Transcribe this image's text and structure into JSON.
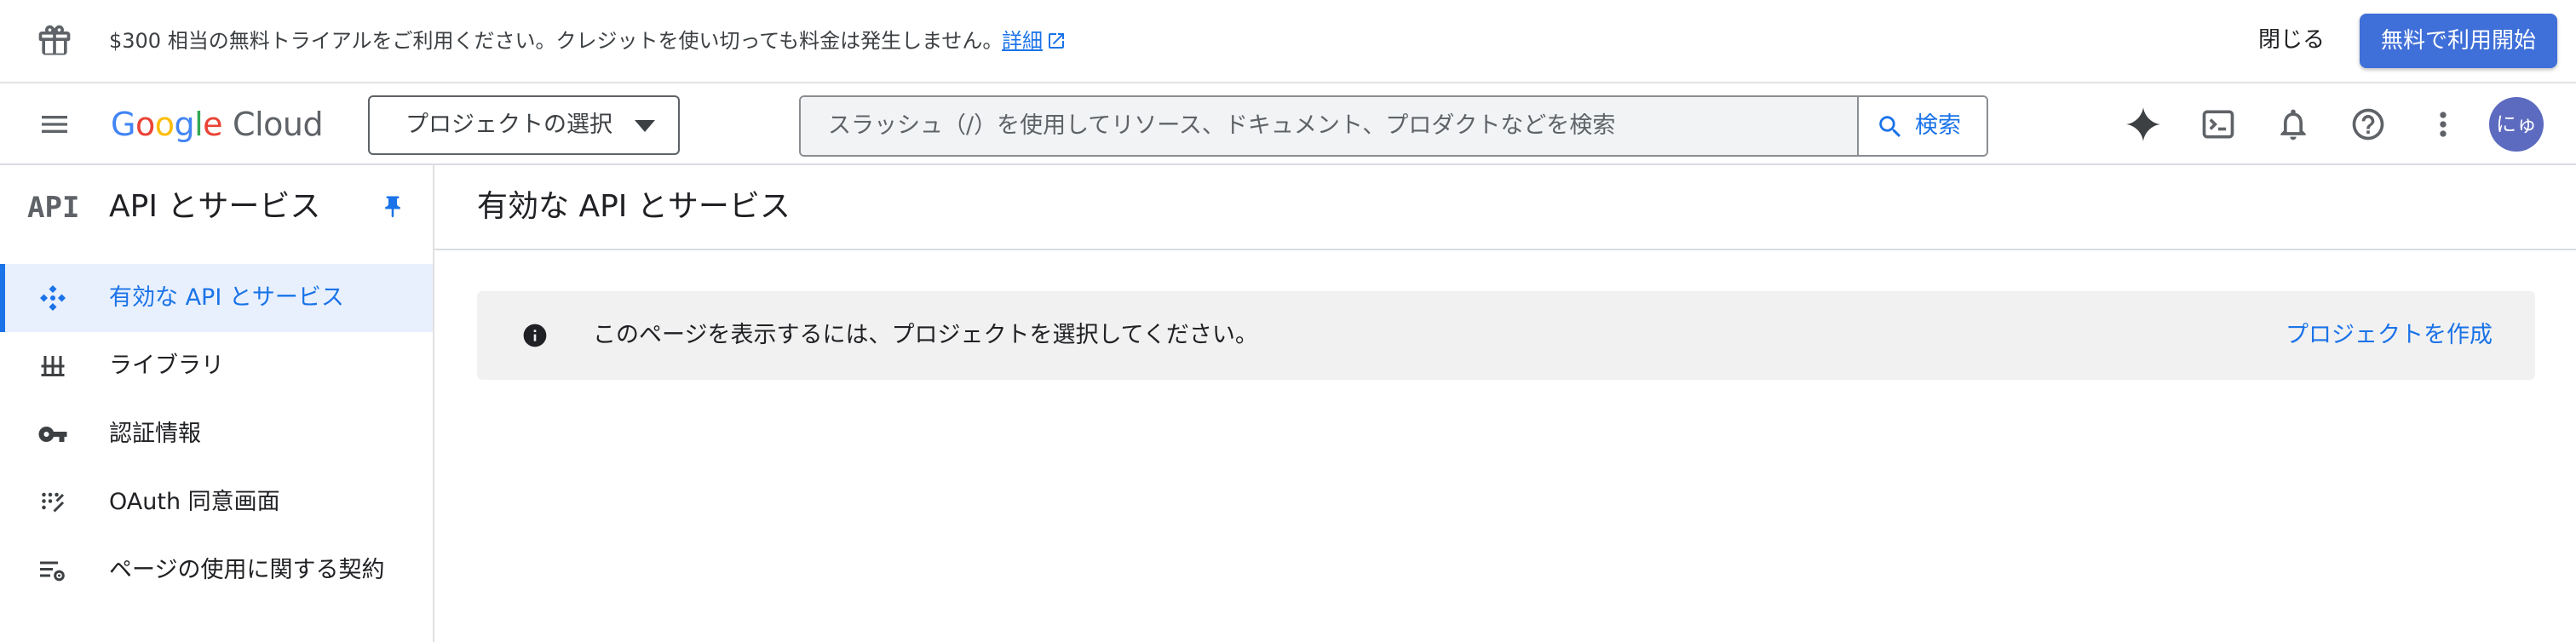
{
  "banner": {
    "message": "$300 相当の無料トライアルをご利用ください。クレジットを使い切っても料金は発生しません。",
    "details_link": "詳細",
    "close_label": "閉じる",
    "trial_button": "無料で利用開始"
  },
  "topbar": {
    "logo_google": [
      "G",
      "o",
      "o",
      "g",
      "l",
      "e"
    ],
    "logo_cloud": "Cloud",
    "project_selector": "プロジェクトの選択",
    "search_placeholder": "スラッシュ（/）を使用してリソース、ドキュメント、プロダクトなどを検索",
    "search_button": "検索",
    "avatar_initials": "にゅ",
    "icons": [
      "gemini-icon",
      "cloud-shell-icon",
      "notifications-icon",
      "help-icon",
      "more-vert-icon"
    ]
  },
  "sidebar": {
    "logo_text": "API",
    "title": "API とサービス",
    "items": [
      {
        "label": "有効な API とサービス",
        "icon": "enabled-apis-icon",
        "active": true
      },
      {
        "label": "ライブラリ",
        "icon": "library-icon",
        "active": false
      },
      {
        "label": "認証情報",
        "icon": "key-icon",
        "active": false
      },
      {
        "label": "OAuth 同意画面",
        "icon": "oauth-consent-icon",
        "active": false
      },
      {
        "label": "ページの使用に関する契約",
        "icon": "page-usage-agreement-icon",
        "active": false
      }
    ]
  },
  "main": {
    "title": "有効な API とサービス",
    "notice_message": "このページを表示するには、プロジェクトを選択してください。",
    "create_project_link": "プロジェクトを作成"
  },
  "colors": {
    "accent": "#1a73e8",
    "trial_button": "#3f6fd8",
    "active_nav_bg": "#e8f0fe",
    "avatar": "#5c6bc0",
    "notice_bg": "#f1f1f1"
  }
}
